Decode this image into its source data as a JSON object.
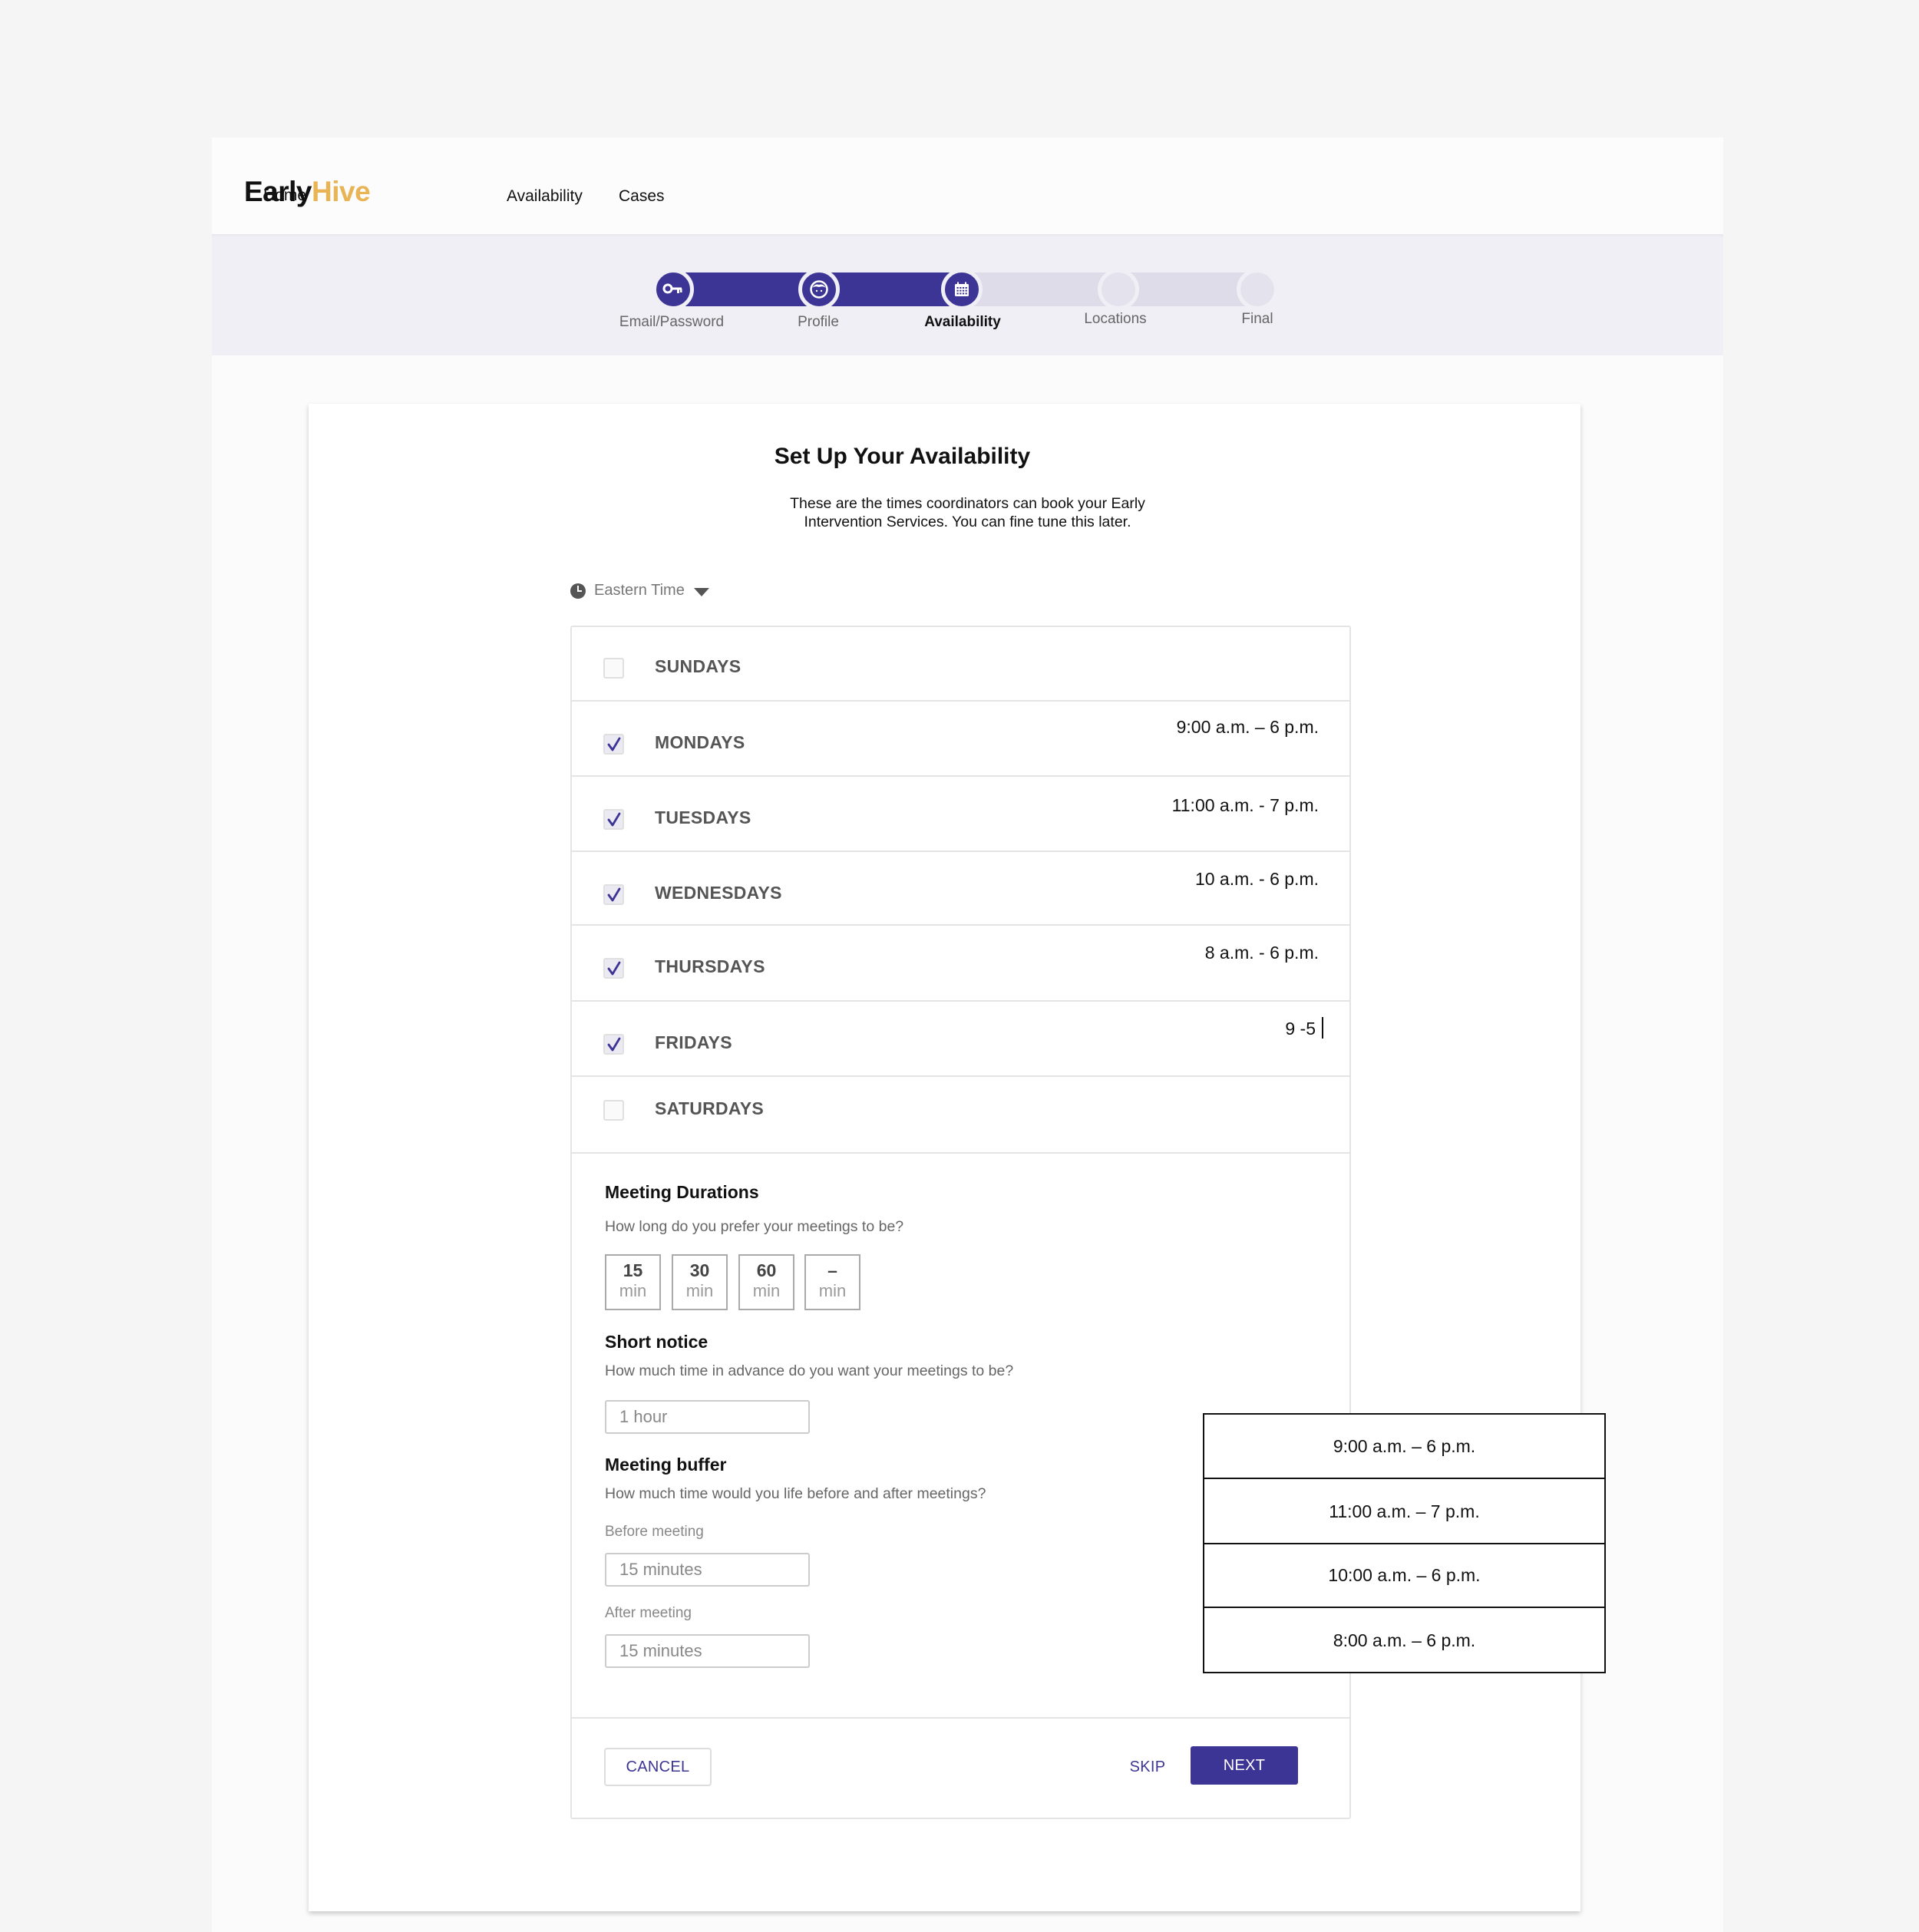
{
  "nav": {
    "logo_part1": "Early",
    "logo_part2": "Hive",
    "links": [
      "Home",
      "Availability",
      "Cases"
    ]
  },
  "stepper": {
    "steps": [
      {
        "label": "Email/Password",
        "icon": "key-icon",
        "state": "done"
      },
      {
        "label": "Profile",
        "icon": "face-icon",
        "state": "done"
      },
      {
        "label": "Availability",
        "icon": "calendar-icon",
        "state": "active"
      },
      {
        "label": "Locations",
        "icon": "",
        "state": "todo"
      },
      {
        "label": "Final",
        "icon": "",
        "state": "todo"
      }
    ]
  },
  "page": {
    "title": "Set Up Your Availability",
    "subtitle_line1": "These are the times coordinators can book your Early",
    "subtitle_line2": "Intervention Services. You can fine tune this later.",
    "timezone": "Eastern Time"
  },
  "days": [
    {
      "name": "SUNDAYS",
      "checked": false,
      "time": ""
    },
    {
      "name": "MONDAYS",
      "checked": true,
      "time": "9:00 a.m. – 6 p.m."
    },
    {
      "name": "TUESDAYS",
      "checked": true,
      "time": "11:00 a.m. - 7 p.m."
    },
    {
      "name": "WEDNESDAYS",
      "checked": true,
      "time": "10 a.m. - 6 p.m."
    },
    {
      "name": "THURSDAYS",
      "checked": true,
      "time": "8 a.m. - 6 p.m."
    },
    {
      "name": "FRIDAYS",
      "checked": true,
      "time": "9 -5"
    },
    {
      "name": "SATURDAYS",
      "checked": false,
      "time": ""
    }
  ],
  "time_suggestions": [
    "9:00 a.m. – 6 p.m.",
    "11:00 a.m. – 7 p.m.",
    "10:00 a.m. – 6 p.m.",
    "8:00 a.m. – 6 p.m."
  ],
  "durations": {
    "title": "Meeting Durations",
    "subtitle": "How long do you prefer your meetings to be?",
    "options": [
      {
        "value": "15",
        "unit": "min"
      },
      {
        "value": "30",
        "unit": "min"
      },
      {
        "value": "60",
        "unit": "min"
      },
      {
        "value": "–",
        "unit": "min"
      }
    ]
  },
  "short_notice": {
    "title": "Short notice",
    "subtitle": "How much time in advance do you want your meetings to be?",
    "value": "1 hour"
  },
  "buffer": {
    "title": "Meeting buffer",
    "subtitle": "How much time would you life before and after meetings?",
    "before_label": "Before meeting",
    "before_value": "15 minutes",
    "after_label": "After meeting",
    "after_value": "15 minutes"
  },
  "actions": {
    "cancel": "CANCEL",
    "skip": "SKIP",
    "next": "NEXT"
  },
  "colors": {
    "primary": "#3d3596",
    "logo_accent": "#e8b456",
    "track_inactive": "#dedce8",
    "stepper_band": "#f0eff6"
  }
}
